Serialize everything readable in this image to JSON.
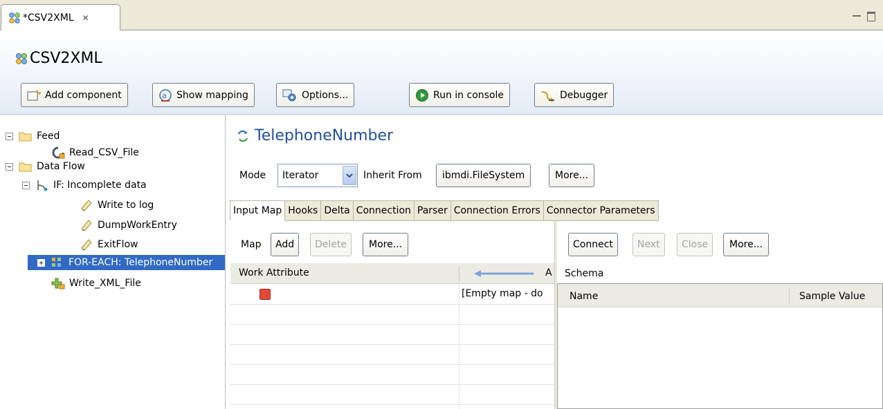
{
  "editor_tab": {
    "label": "*CSV2XML",
    "close_glyph": "✕"
  },
  "window_controls": {
    "minimize_icon": "minimize-icon",
    "maximize_icon": "maximize-icon"
  },
  "header": {
    "title": "CSV2XML"
  },
  "toolbar": {
    "add_component": "Add component",
    "show_mapping": "Show mapping",
    "options": "Options...",
    "run_in_console": "Run in console",
    "debugger": "Debugger"
  },
  "tree": {
    "items": [
      {
        "label": "Feed",
        "icon": "folder-icon"
      },
      {
        "label": "Read_CSV_File",
        "icon": "connector-read-icon"
      },
      {
        "label": "Data Flow",
        "icon": "folder-icon"
      },
      {
        "label": "IF: Incomplete data",
        "icon": "branch-icon"
      },
      {
        "label": "Write to log",
        "icon": "script-icon"
      },
      {
        "label": "DumpWorkEntry",
        "icon": "script-icon"
      },
      {
        "label": "ExitFlow",
        "icon": "script-icon"
      },
      {
        "label": "FOR-EACH: TelephoneNumber",
        "icon": "loop-icon"
      },
      {
        "label": "Write_XML_File",
        "icon": "connector-write-icon"
      }
    ]
  },
  "component": {
    "title": "TelephoneNumber",
    "mode_label": "Mode",
    "mode_value": "Iterator",
    "inherit_label": "Inherit From",
    "inherit_value": "ibmdi.FileSystem",
    "more_label": "More..."
  },
  "tabs": [
    "Input Map",
    "Hooks",
    "Delta",
    "Connection",
    "Parser",
    "Connection Errors",
    "Connector Parameters"
  ],
  "map_toolbar": {
    "label": "Map",
    "add": "Add",
    "delete": "Delete",
    "more": "More..."
  },
  "map_table": {
    "col_work_attribute": "Work Attribute",
    "col_assignment": "A",
    "empty_text": "[Empty map - do"
  },
  "schema_toolbar": {
    "connect": "Connect",
    "next": "Next",
    "close": "Close",
    "more": "More..."
  },
  "schema": {
    "label": "Schema",
    "col_name": "Name",
    "col_sample": "Sample Value"
  },
  "colors": {
    "selection": "#316ac5",
    "title_blue": "#1f4f9f",
    "tab_bg": "#ece9d8"
  }
}
